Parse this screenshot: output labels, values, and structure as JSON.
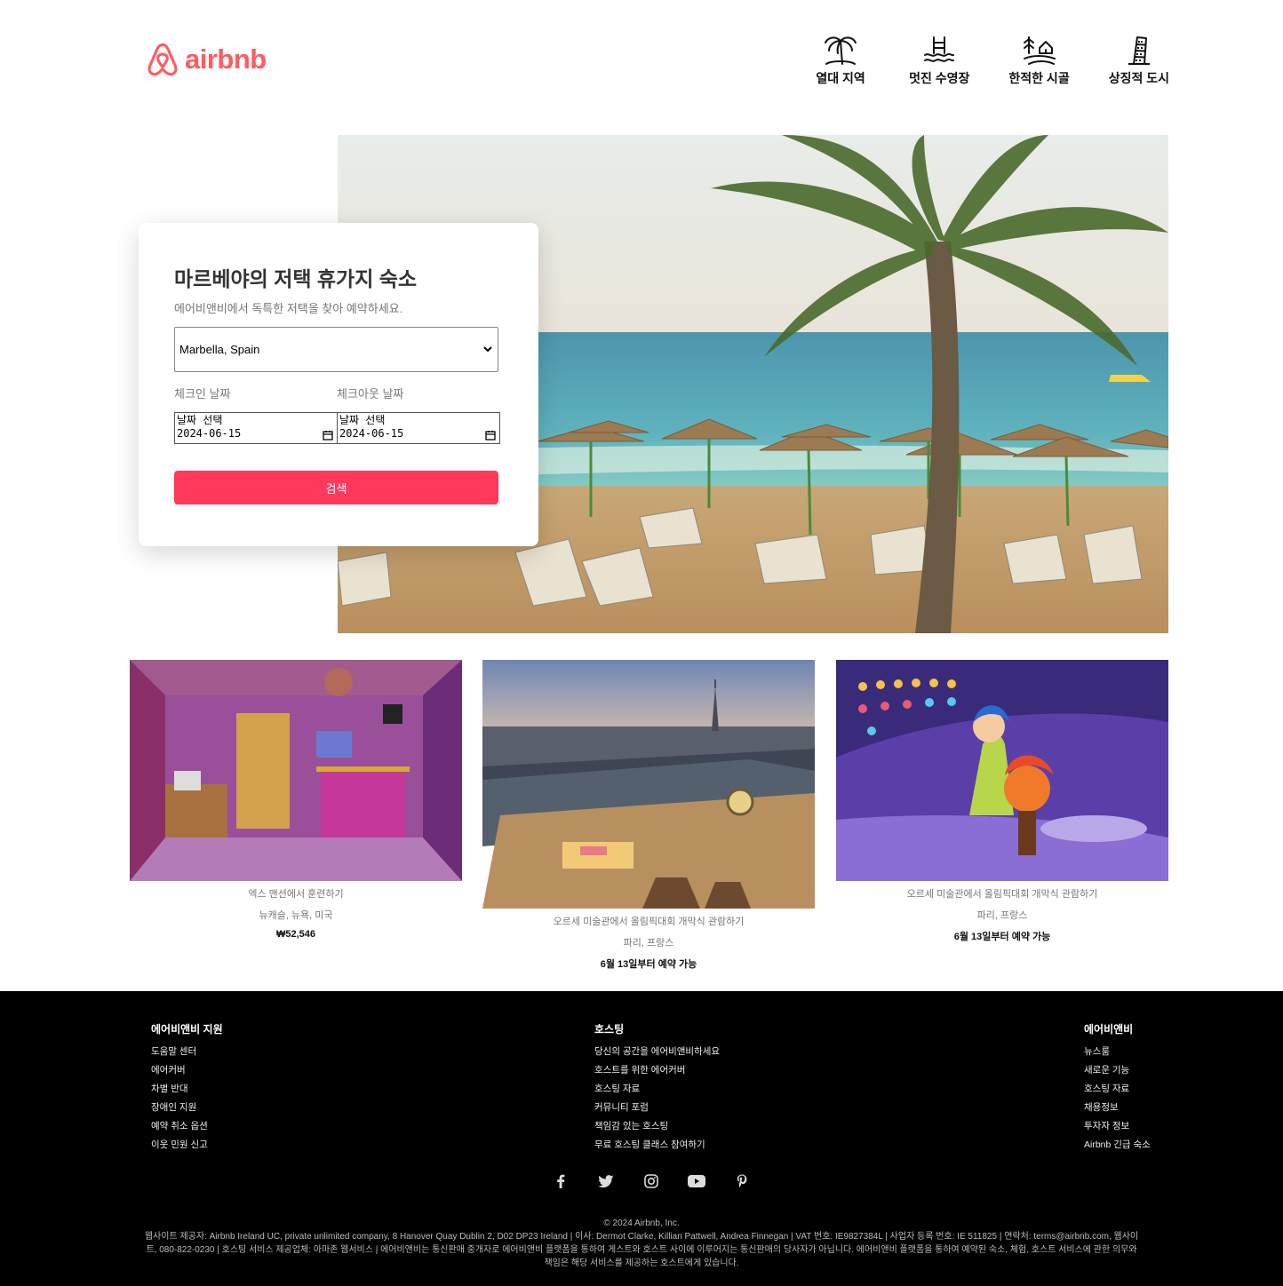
{
  "brand": {
    "name": "airbnb",
    "color": "#ff5a5f"
  },
  "categories": [
    {
      "label": "열대 지역",
      "icon": "palm-tree-icon"
    },
    {
      "label": "멋진 수영장",
      "icon": "pool-icon"
    },
    {
      "label": "한적한 시골",
      "icon": "countryside-icon"
    },
    {
      "label": "상징적 도시",
      "icon": "leaning-tower-icon"
    }
  ],
  "search": {
    "title": "마르베야의 저택 휴가지 숙소",
    "subtitle": "에어비앤비에서 독특한 저택을 찾아 예약하세요.",
    "location": "Marbella, Spain",
    "checkin_label": "체크인 날짜",
    "checkout_label": "체크아웃 날짜",
    "date_placeholder": "날짜 선택",
    "checkin_value": "2024-06-15",
    "checkout_value": "2024-06-15",
    "button": "검색",
    "button_color": "#ff385c"
  },
  "listings": [
    {
      "title": "엑스 맨션에서 훈련하기",
      "location": "뉴캐슬, 뉴욕, 미국",
      "price": "₩52,546"
    },
    {
      "title": "오르세 미술관에서 올림픽대회 개막식 관람하기",
      "location": "파리, 프랑스",
      "price": "6월 13일부터 예약 가능"
    },
    {
      "title": "오르세 미술관에서 올림픽대회 개막식 관람하기",
      "location": "파리, 프랑스",
      "price": "6월 13일부터 예약 가능"
    }
  ],
  "footer": {
    "col1": {
      "title": "에어비앤비 지원",
      "links": [
        "도움말 센터",
        "에어커버",
        "차별 반대",
        "장애인 지원",
        "예약 취소 옵션",
        "이웃 민원 신고"
      ]
    },
    "col2": {
      "title": "호스팅",
      "links": [
        "당신의 공간을 에어비앤비하세요",
        "호스트를 위한 에어커버",
        "호스팅 자료",
        "커뮤니티 포럼",
        "책임감 있는 호스팅",
        "무료 호스팅 클래스 참여하기"
      ]
    },
    "col3": {
      "title": "에어비앤비",
      "links": [
        "뉴스룸",
        "새로운 기능",
        "호스팅 자료",
        "채용정보",
        "투자자 정보",
        "Airbnb 긴급 숙소"
      ]
    },
    "social": [
      "facebook-icon",
      "twitter-icon",
      "instagram-icon",
      "youtube-icon",
      "pinterest-icon"
    ],
    "copyright": "© 2024 Airbnb, Inc.",
    "legal": "웹사이트 제공자: Airbnb Ireland UC, private unlimited company, 8 Hanover Quay Dublin 2, D02 DP23 Ireland | 이사: Dermot Clarke, Killian Pattwell, Andrea Finnegan | VAT 번호: IE9827384L | 사업자 등록 번호: IE 511825 | 연락처: terms@airbnb.com, 웹사이트, 080-822-0230 | 호스팅 서비스 제공업체: 아마존 웹서비스 | 에어비앤비는 통신판매 중개자로 에어비앤비 플랫폼을 통하여 게스트와 호스트 사이에 이루어지는 통신판매의 당사자가 아닙니다. 에어비앤비 플랫폼을 통하여 예약된 숙소, 체험, 호스트 서비스에 관한 의무와 책임은 해당 서비스를 제공하는 호스트에게 있습니다."
  }
}
